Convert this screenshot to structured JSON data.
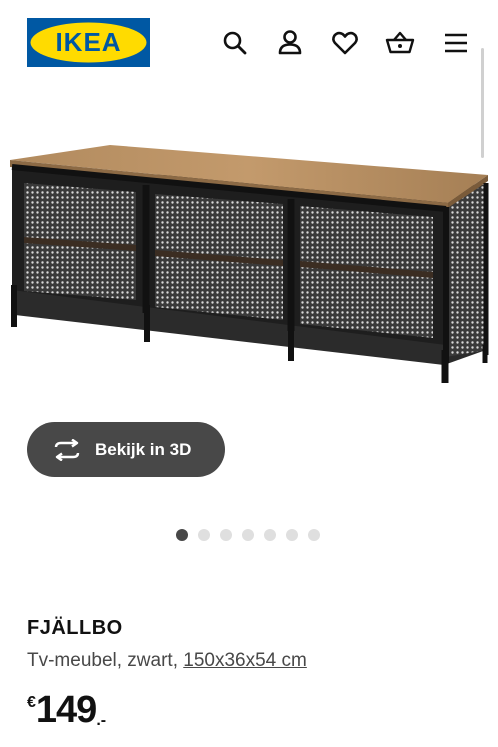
{
  "header": {
    "logo_text": "IKEA",
    "icons": [
      "search-icon",
      "user-icon",
      "heart-icon",
      "basket-icon",
      "menu-icon"
    ]
  },
  "colors": {
    "brand_blue": "#0058a3",
    "brand_yellow": "#ffdb00",
    "button_dark": "#484848",
    "dot_inactive": "#dfdfdf"
  },
  "view3d": {
    "label": "Bekijk in 3D"
  },
  "carousel": {
    "count": 7,
    "active_index": 1
  },
  "product": {
    "name": "FJÄLLBO",
    "description": "Tv-meubel, zwart,",
    "dimensions": "150x36x54 cm",
    "price": {
      "currency": "€",
      "amount": "149",
      "decimal": ".-"
    }
  }
}
